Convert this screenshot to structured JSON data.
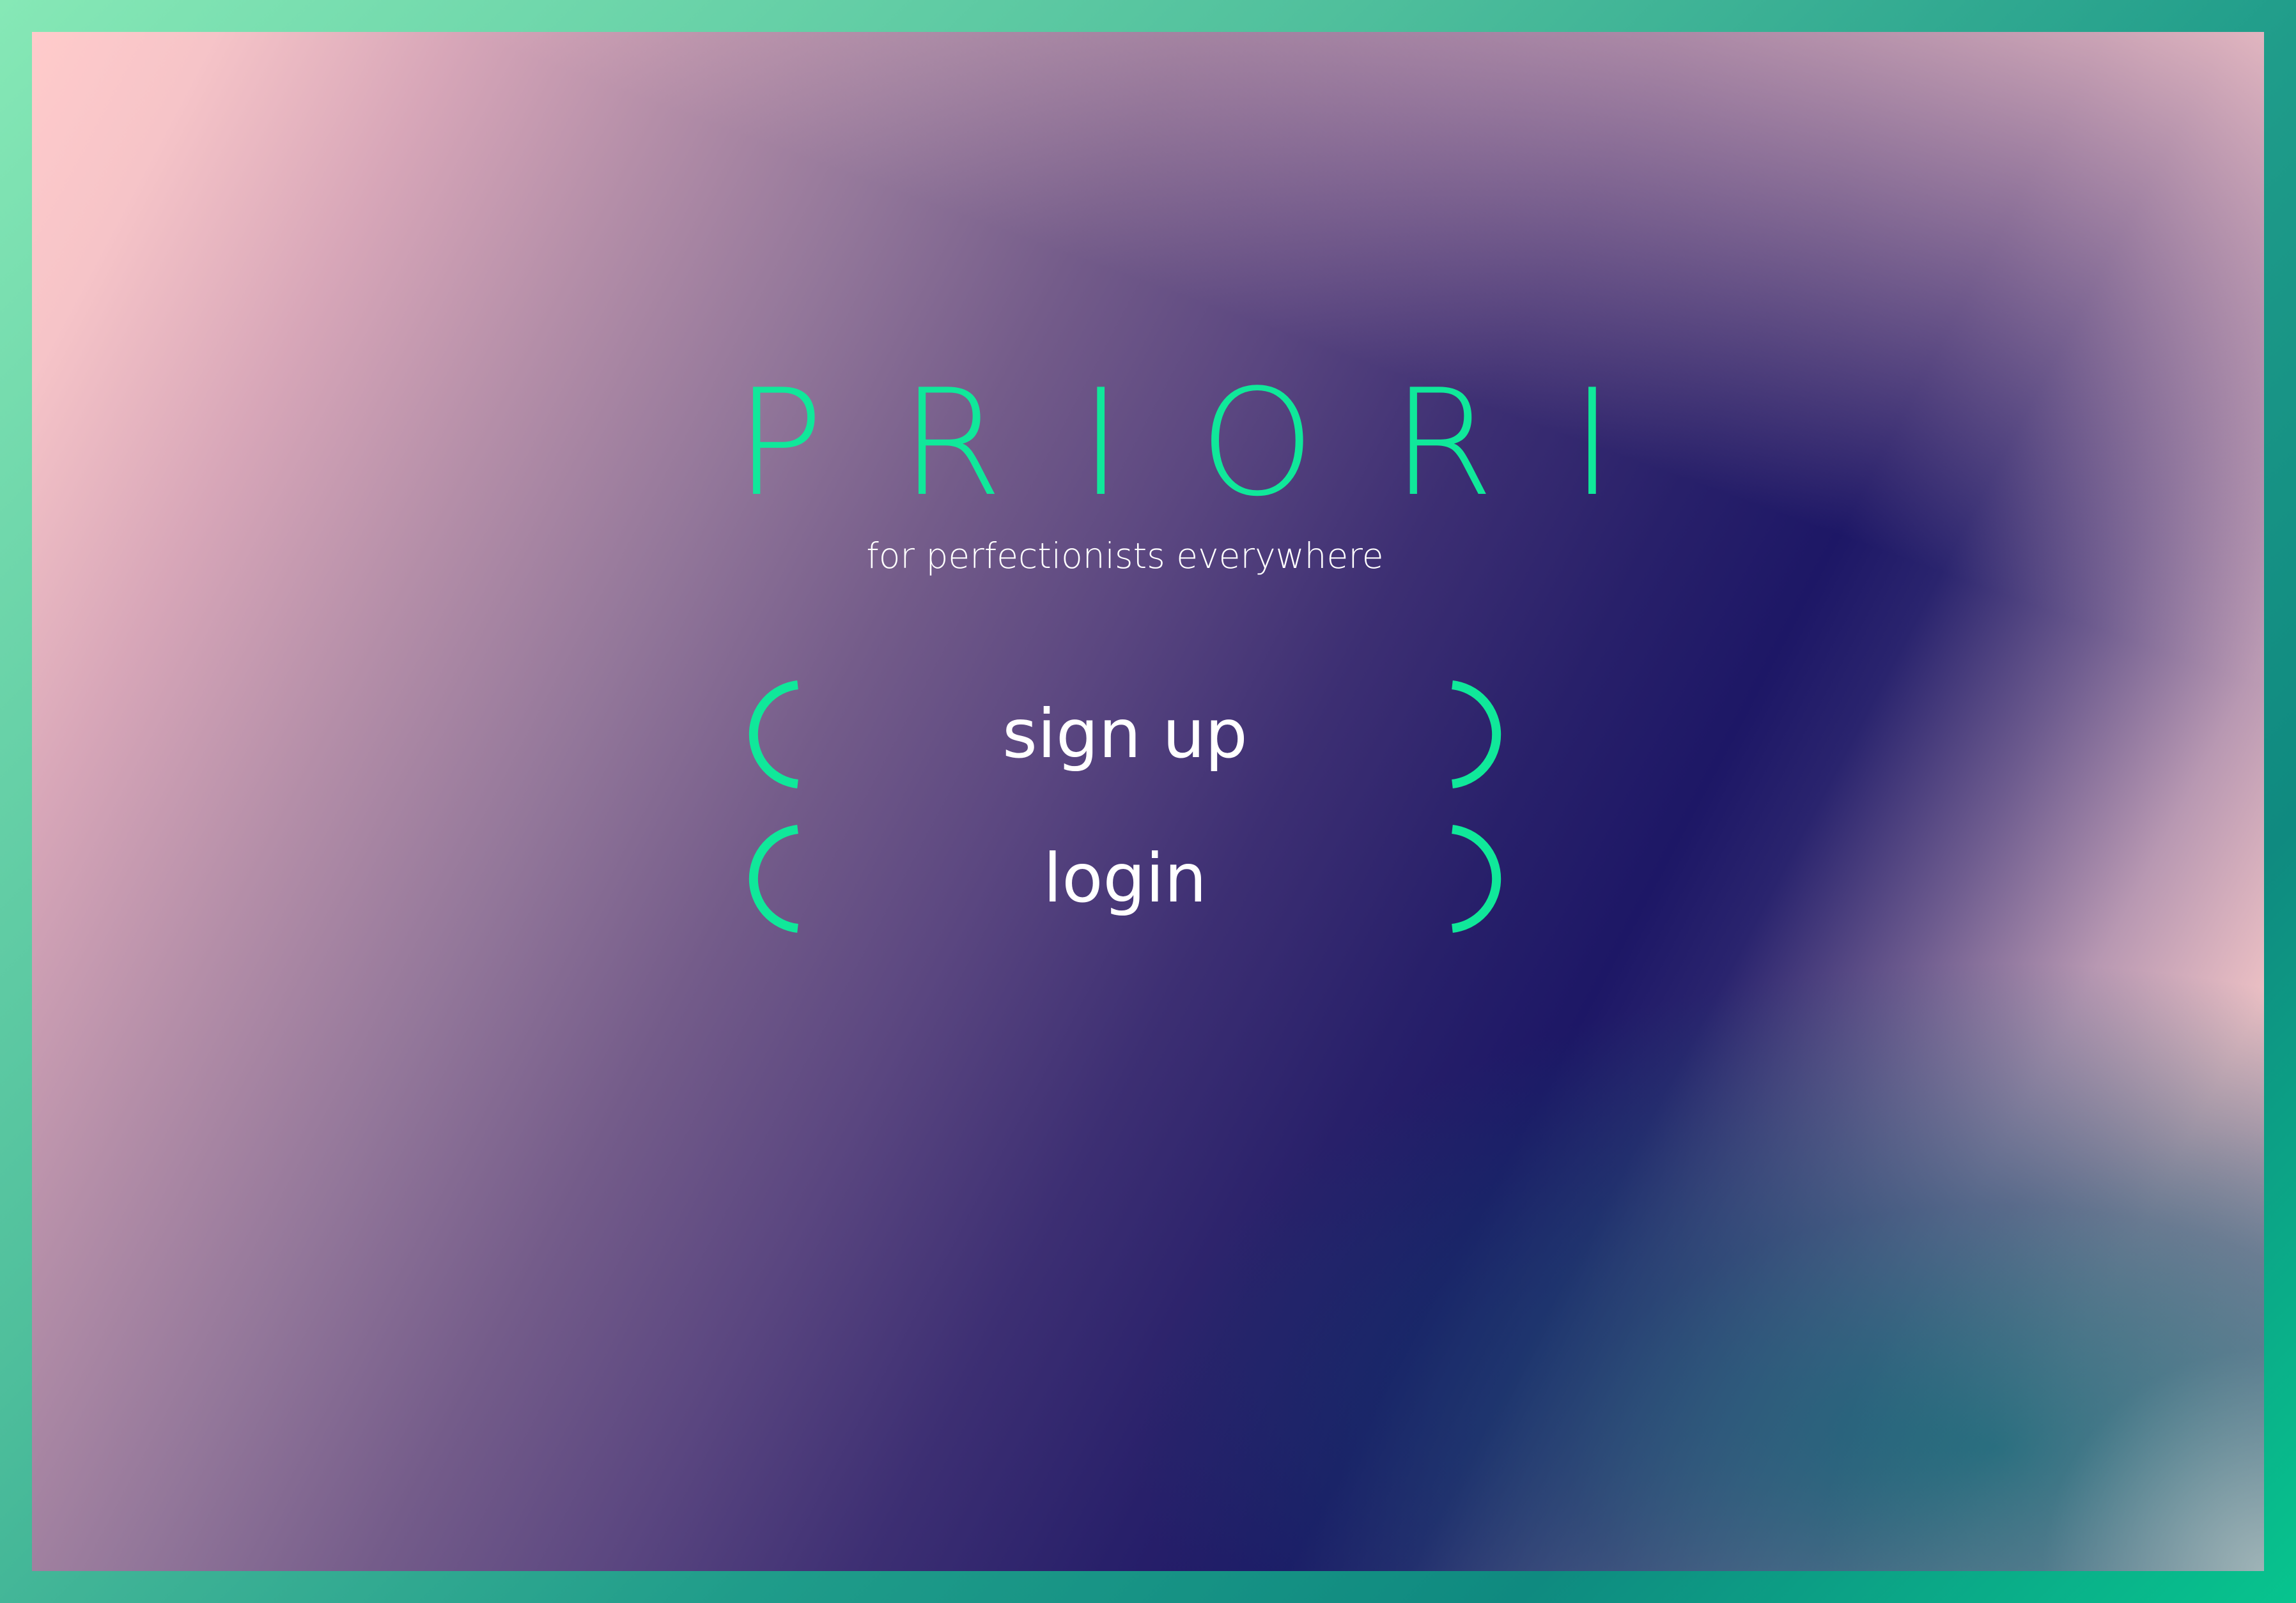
{
  "app": {
    "logo_text": "PRIORI",
    "tagline": "for perfectionists everywhere"
  },
  "actions": {
    "signup_label": "sign up",
    "login_label": "login"
  },
  "colors": {
    "accent": "#10e89a",
    "text": "#ffffff",
    "frame": "#2fb292",
    "background_pink": "#ffcbcb",
    "background_navy": "#1d1766"
  },
  "icons": {
    "left_bracket": "left-parenthesis-bracket-icon",
    "right_bracket": "right-parenthesis-bracket-icon"
  }
}
